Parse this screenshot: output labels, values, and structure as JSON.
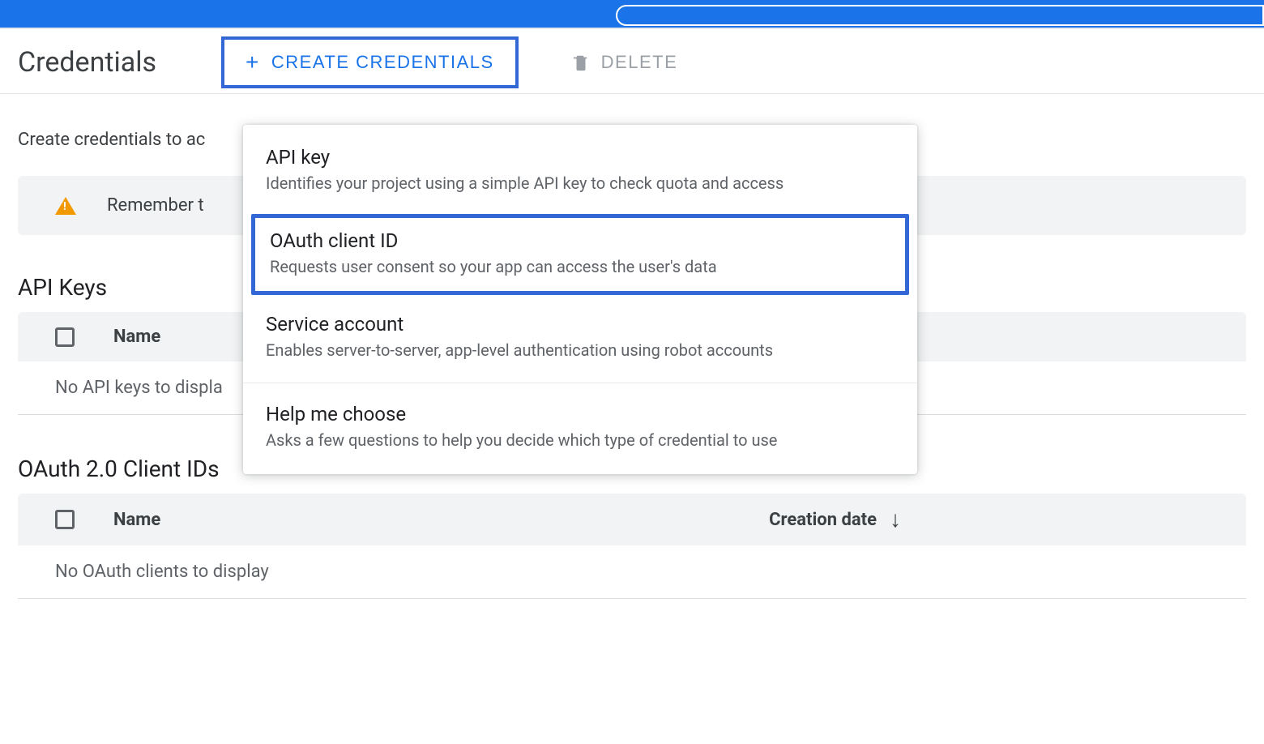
{
  "header": {
    "page_title": "Credentials",
    "create_credentials_label": "CREATE CREDENTIALS",
    "delete_label": "DELETE"
  },
  "subline_text_visible": "Create credentials to ac",
  "banner_text_visible": "Remember t",
  "dropdown": {
    "items": [
      {
        "title": "API key",
        "desc": "Identifies your project using a simple API key to check quota and access"
      },
      {
        "title": "OAuth client ID",
        "desc": "Requests user consent so your app can access the user's data",
        "highlighted": true
      },
      {
        "title": "Service account",
        "desc": "Enables server-to-server, app-level authentication using robot accounts"
      },
      {
        "title": "Help me choose",
        "desc": "Asks a few questions to help you decide which type of credential to use"
      }
    ]
  },
  "sections": {
    "api_keys": {
      "title": "API Keys",
      "columns": {
        "name": "Name"
      },
      "empty_visible": "No API keys to displa"
    },
    "oauth_clients": {
      "title": "OAuth 2.0 Client IDs",
      "columns": {
        "name": "Name",
        "creation_date": "Creation date"
      },
      "empty": "No OAuth clients to display"
    }
  },
  "colors": {
    "accent": "#1a73e8",
    "highlight_border": "#3367d6",
    "banner_bg": "#f1f3f4",
    "warning": "#f29900",
    "text_secondary": "#5f6368"
  }
}
